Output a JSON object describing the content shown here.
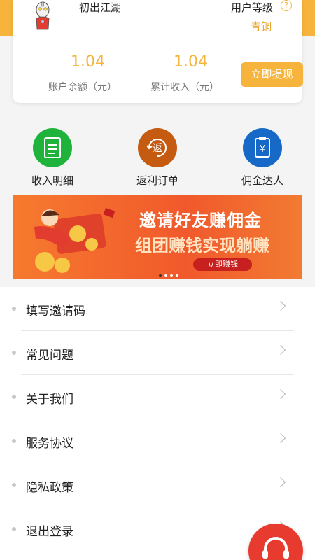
{
  "profile": {
    "nickname": "初出江湖",
    "level_label": "用户等级",
    "level_value": "青铜"
  },
  "stats": {
    "balance_value": "1.04",
    "balance_label": "账户余额（元）",
    "total_value": "1.04",
    "total_label": "累计收入（元）",
    "withdraw_button": "立即提现"
  },
  "shortcuts": [
    {
      "label": "收入明细",
      "icon": "document-icon",
      "color": "#1fb33b"
    },
    {
      "label": "返利订单",
      "icon": "rebate-icon",
      "color": "#c55a11"
    },
    {
      "label": "佣金达人",
      "icon": "clipboard-yen-icon",
      "color": "#1669c7"
    }
  ],
  "banner": {
    "title": "邀请好友赚佣金",
    "subtitle": "组团赚钱实现躺赚",
    "button": "立即赚钱"
  },
  "menu": [
    {
      "label": "填写邀请码"
    },
    {
      "label": "常见问题"
    },
    {
      "label": "关于我们"
    },
    {
      "label": "服务协议"
    },
    {
      "label": "隐私政策"
    },
    {
      "label": "退出登录"
    }
  ],
  "colors": {
    "accent": "#f6b43c",
    "fab": "#e83b2f"
  }
}
